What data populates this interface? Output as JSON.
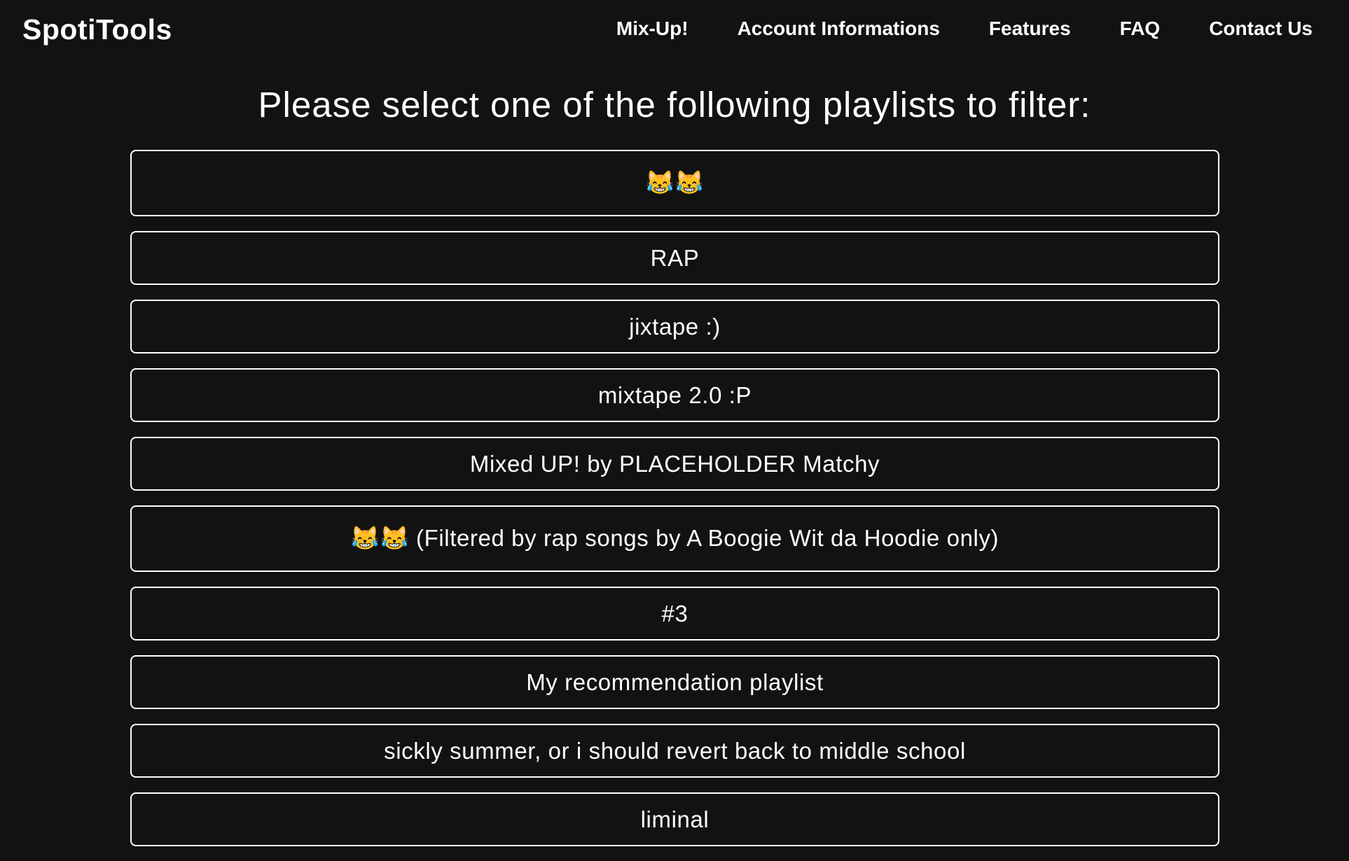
{
  "brand": "SpotiTools",
  "nav": [
    "Mix-Up!",
    "Account Informations",
    "Features",
    "FAQ",
    "Contact Us"
  ],
  "title": "Please select one of the following playlists to filter:",
  "playlists": [
    "😹😹",
    "RAP",
    "jixtape :)",
    "mixtape 2.0 :P",
    "Mixed UP! by PLACEHOLDER Matchy",
    "😹😹 (Filtered by rap songs by A Boogie Wit da Hoodie only)",
    "#3",
    "My recommendation playlist",
    "sickly summer, or i should revert back to middle school",
    "liminal"
  ],
  "colors": {
    "background": "#121212",
    "text": "#ffffff",
    "border": "#ffffff"
  }
}
